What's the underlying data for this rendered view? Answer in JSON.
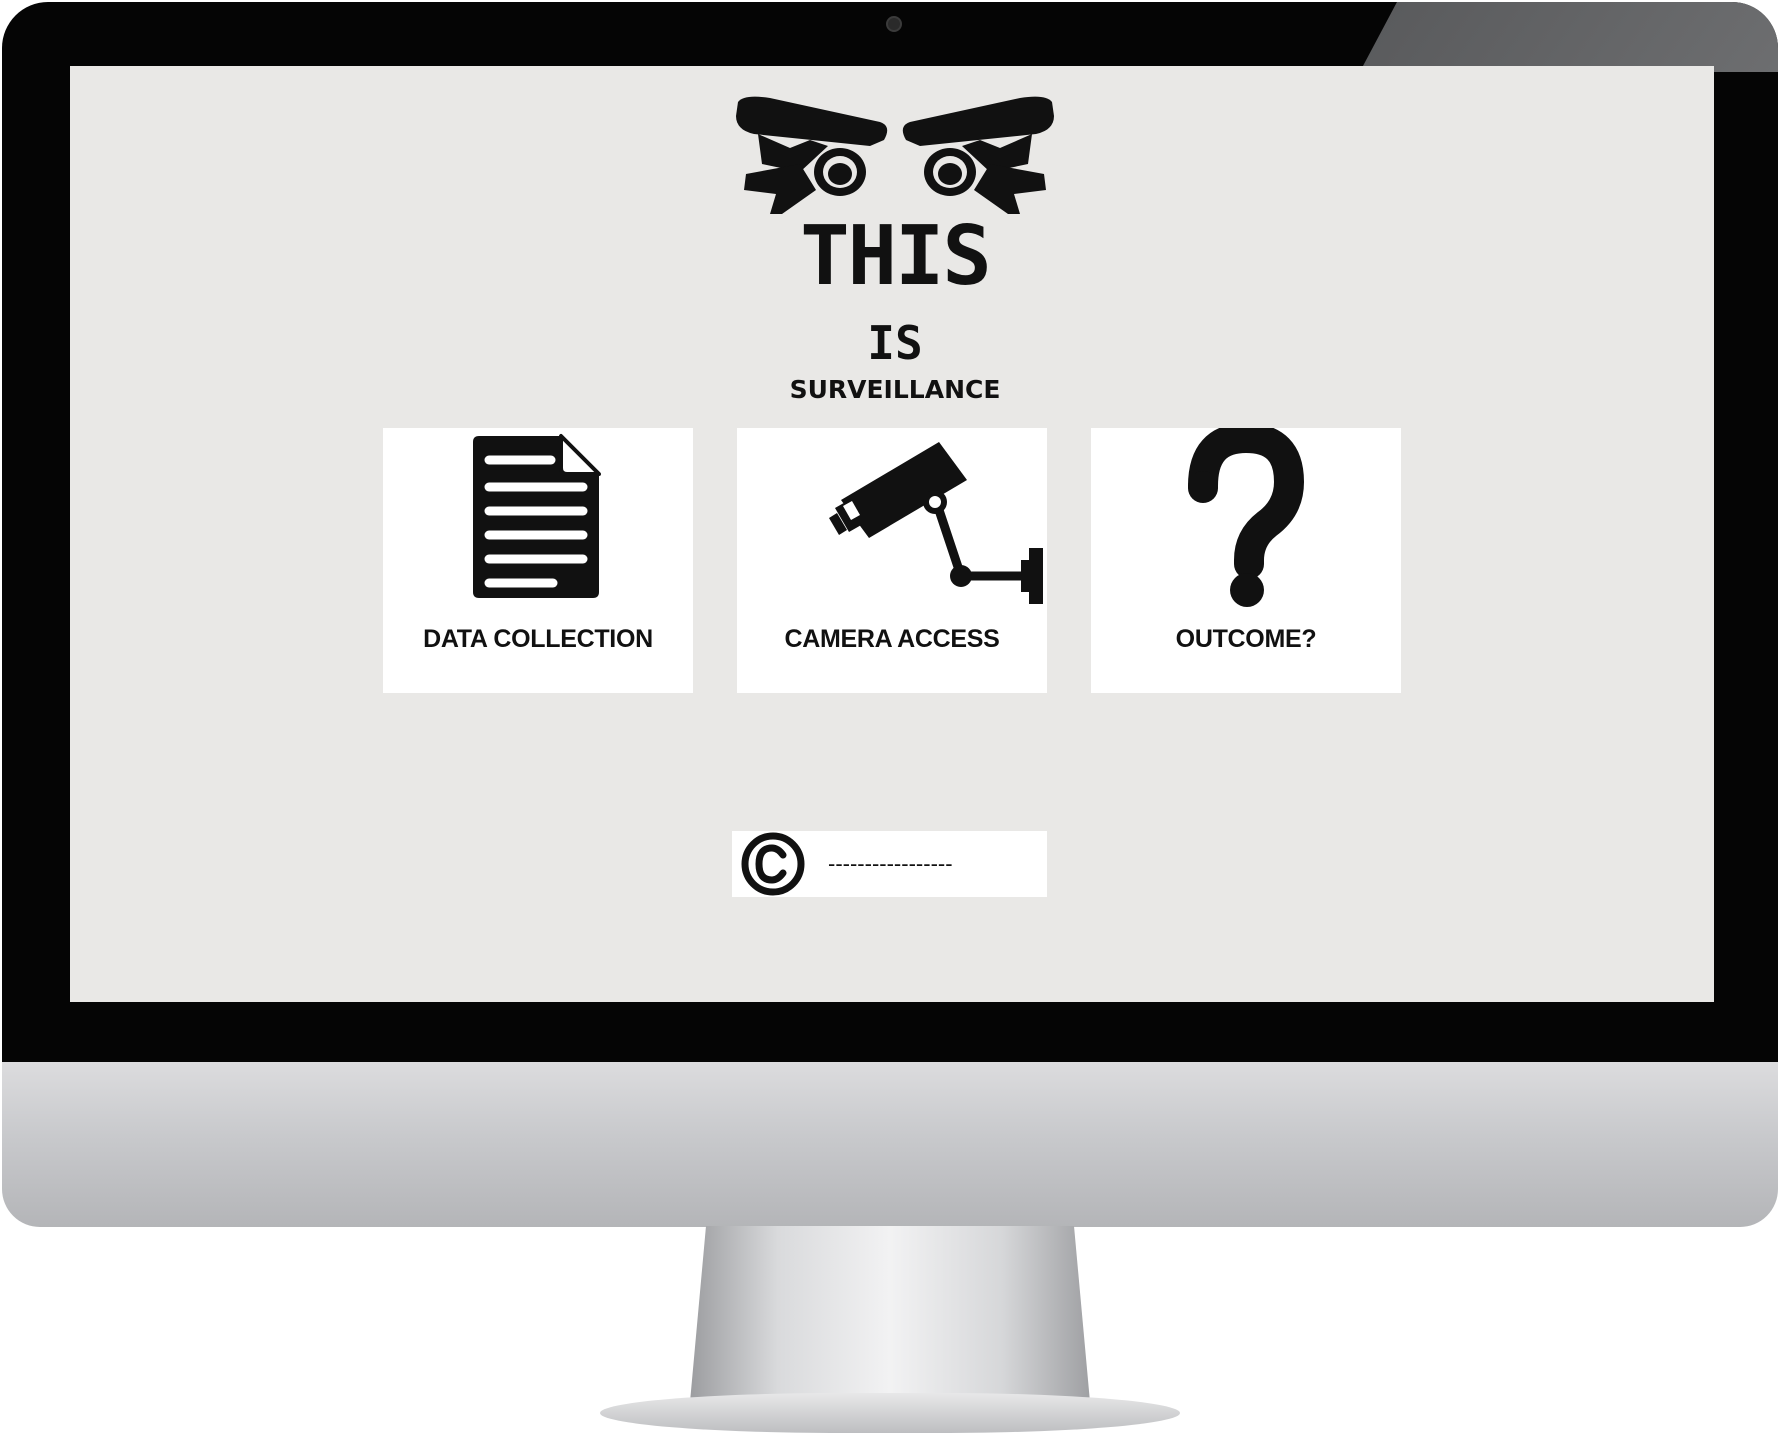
{
  "logo": {
    "title_line1": "THIS",
    "title_line2": "IS",
    "title_line3": "SURVEILLANCE",
    "icon": "security-cameras-icon"
  },
  "tiles": [
    {
      "label": "DATA COLLECTION",
      "icon": "document-icon"
    },
    {
      "label": "CAMERA ACCESS",
      "icon": "security-camera-icon"
    },
    {
      "label": "OUTCOME?",
      "icon": "question-mark-icon"
    }
  ],
  "footer": {
    "icon": "copyright-icon",
    "text": "-----------------"
  },
  "colors": {
    "screen_background": "#e9e8e6",
    "tile_background": "#ffffff",
    "ink": "#111111",
    "bezel": "#050505"
  }
}
